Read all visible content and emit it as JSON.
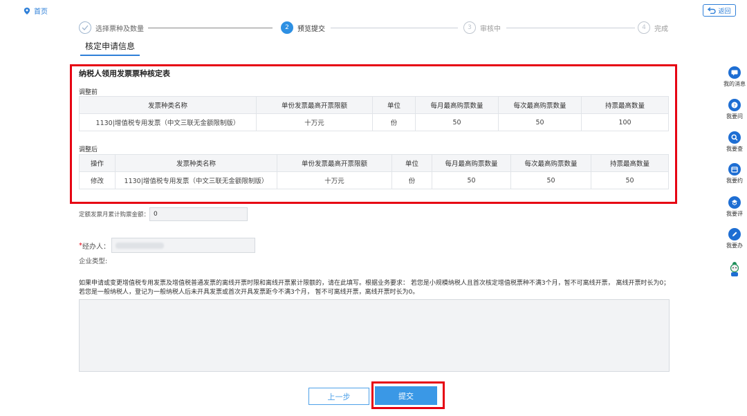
{
  "nav": {
    "home_label": "首页",
    "back_label": "返回"
  },
  "steps": [
    {
      "index": "✓",
      "label": "选择票种及数量",
      "state": "done"
    },
    {
      "index": "2",
      "label": "预览提交",
      "state": "active"
    },
    {
      "index": "3",
      "label": "审核中",
      "state": "pending"
    },
    {
      "index": "4",
      "label": "完成",
      "state": "pending"
    }
  ],
  "section_title": "核定申请信息",
  "form": {
    "title": "纳税人领用发票票种核定表",
    "before_label": "调整前",
    "after_label": "调整后",
    "before_table": {
      "headers": [
        "发票种类名称",
        "单份发票最高开票限额",
        "单位",
        "每月最高购票数量",
        "每次最高购票数量",
        "持票最高数量"
      ],
      "rows": [
        [
          "1130|增值税专用发票（中文三联无金额限制版）",
          "十万元",
          "份",
          "50",
          "50",
          "100"
        ]
      ]
    },
    "after_table": {
      "headers": [
        "操作",
        "发票种类名称",
        "单份发票最高开票限额",
        "单位",
        "每月最高购票数量",
        "每次最高购票数量",
        "持票最高数量"
      ],
      "rows": [
        [
          "修改",
          "1130|增值税专用发票（中文三联无金额限制版）",
          "十万元",
          "份",
          "50",
          "50",
          "50"
        ]
      ]
    }
  },
  "fields": {
    "quota_label": "定额发票月累计购票金额：",
    "quota_value": "0",
    "agent_label": "经办人：",
    "agent_required_mark": "*",
    "company_type_label": "企业类型:"
  },
  "note": "如果申请或变更增值税专用发票及增值税普通发票的离线开票时限和离线开票累计限额的，请在此填写。根据业务要求： 若您是小规模纳税人且首次核定增值税票种不满3个月，暂不可离线开票， 离线开票时长为0；若您是一般纳税人，登记为一般纳税人后未开具发票或首次开具发票距今不满3个月， 暂不可离线开票，离线开票时长为0。",
  "buttons": {
    "prev": "上一步",
    "submit": "提交"
  },
  "sidebar": [
    {
      "label": "我的消息",
      "icon": "message-icon"
    },
    {
      "label": "我要问",
      "icon": "question-icon"
    },
    {
      "label": "我要查",
      "icon": "search-icon"
    },
    {
      "label": "我要约",
      "icon": "calendar-icon"
    },
    {
      "label": "我要评",
      "icon": "rating-icon"
    },
    {
      "label": "我要办",
      "icon": "edit-icon"
    },
    {
      "label": "",
      "icon": "robot-assistant-icon"
    }
  ],
  "colors": {
    "accent": "#2e7fd8",
    "highlight_box": "#e60012",
    "primary_button": "#3a98e6"
  }
}
